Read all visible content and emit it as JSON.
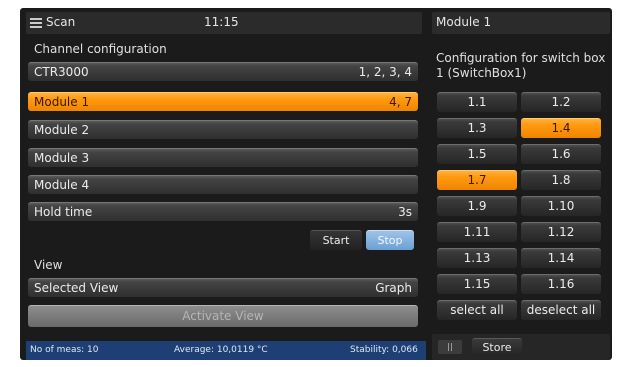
{
  "header": {
    "title": "Scan",
    "time": "11:15"
  },
  "channel": {
    "section_label": "Channel configuration",
    "rows": [
      {
        "label": "CTR3000",
        "value": "1, 2, 3, 4",
        "active": false
      },
      {
        "label": "Module 1",
        "value": "4, 7",
        "active": true
      },
      {
        "label": "Module 2",
        "value": "",
        "active": false
      },
      {
        "label": "Module 3",
        "value": "",
        "active": false
      },
      {
        "label": "Module 4",
        "value": "",
        "active": false
      }
    ],
    "hold_time": {
      "label": "Hold time",
      "value": "3s"
    },
    "start_label": "Start",
    "stop_label": "Stop"
  },
  "view": {
    "section_label": "View",
    "selected_label": "Selected View",
    "selected_value": "Graph",
    "activate_label": "Activate View"
  },
  "status": {
    "meas": "No of meas: 10",
    "average": "Average: 10,0119 °C",
    "stability": "Stability: 0,066"
  },
  "module_panel": {
    "title": "Module 1",
    "subtitle": "Configuration for switch box 1 (SwitchBox1)",
    "switches": [
      {
        "label": "1.1",
        "on": false
      },
      {
        "label": "1.2",
        "on": false
      },
      {
        "label": "1.3",
        "on": false
      },
      {
        "label": "1.4",
        "on": true
      },
      {
        "label": "1.5",
        "on": false
      },
      {
        "label": "1.6",
        "on": false
      },
      {
        "label": "1.7",
        "on": true
      },
      {
        "label": "1.8",
        "on": false
      },
      {
        "label": "1.9",
        "on": false
      },
      {
        "label": "1.10",
        "on": false
      },
      {
        "label": "1.11",
        "on": false
      },
      {
        "label": "1.12",
        "on": false
      },
      {
        "label": "1.13",
        "on": false
      },
      {
        "label": "1.14",
        "on": false
      },
      {
        "label": "1.15",
        "on": false
      },
      {
        "label": "1.16",
        "on": false
      }
    ],
    "select_all_label": "select all",
    "deselect_all_label": "deselect all",
    "store_label": "Store"
  },
  "colors": {
    "accent_orange": "#ff9a10",
    "stop_blue": "#7aa9d8",
    "status_blue": "#1d3f73",
    "panel_bg": "#1b1b1b"
  }
}
